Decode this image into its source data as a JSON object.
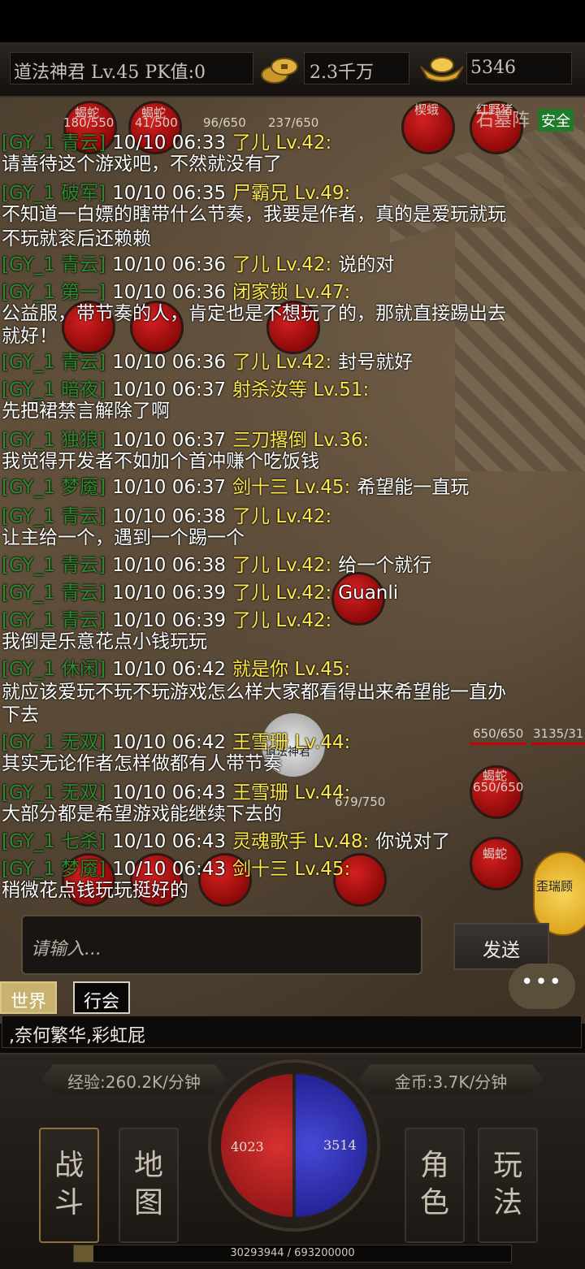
{
  "header": {
    "player_info": "道法神君  Lv.45 PK值:0",
    "gold": "2.3千万",
    "ingot": "5346"
  },
  "scene": {
    "zone": "石墓阵",
    "safe_zone": "安全",
    "player_name": "道法神君",
    "npc_name": "歪瑞顾",
    "monsters": [
      {
        "name": "蝎蛇",
        "hp": "180/550"
      },
      {
        "name": "蝎蛇",
        "hp": "41/500"
      },
      {
        "name": "",
        "hp": "96/650"
      },
      {
        "name": "",
        "hp": "237/650"
      },
      {
        "name": "楔蛾",
        "hp": ""
      },
      {
        "name": "红野猪",
        "hp": ""
      },
      {
        "name": "蝎蛇",
        "hp": "650/650"
      },
      {
        "name": "",
        "hp": "3135/31"
      },
      {
        "name": "",
        "hp": "679/750"
      },
      {
        "name": "蝎蛇",
        "hp": ""
      }
    ]
  },
  "chat": {
    "lines": [
      {
        "channel": "[GY_1  青云]",
        "time": "10/10 06:33",
        "name": "了儿 Lv.42:",
        "msg": ""
      },
      {
        "channel": "",
        "time": "",
        "name": "",
        "msg": "请善待这个游戏吧，不然就没有了"
      },
      {
        "channel": "[GY_1  破军]",
        "time": "10/10 06:35",
        "name": "尸霸兄 Lv.49:",
        "msg": ""
      },
      {
        "channel": "",
        "time": "",
        "name": "",
        "msg": "不知道一白嫖的瞎带什么节奏，我要是作者，真的是爱玩就玩"
      },
      {
        "channel": "",
        "time": "",
        "name": "",
        "msg": "不玩就衮后还赖赖"
      },
      {
        "channel": "[GY_1  青云]",
        "time": "10/10 06:36",
        "name": "了儿 Lv.42:",
        "msg": "说的对"
      },
      {
        "channel": "[GY_1  第一]",
        "time": "10/10 06:36",
        "name": "闭家锁 Lv.47:",
        "msg": ""
      },
      {
        "channel": "",
        "time": "",
        "name": "",
        "msg": "公益服，带节奏的人，肯定也是不想玩了的，那就直接踢出去"
      },
      {
        "channel": "",
        "time": "",
        "name": "",
        "msg": "就好！"
      },
      {
        "channel": "[GY_1  青云]",
        "time": "10/10 06:36",
        "name": "了儿 Lv.42:",
        "msg": "封号就好"
      },
      {
        "channel": "[GY_1  暗夜]",
        "time": "10/10 06:37",
        "name": "射杀汝等 Lv.51:",
        "msg": ""
      },
      {
        "channel": "",
        "time": "",
        "name": "",
        "msg": "先把裙禁言解除了啊"
      },
      {
        "channel": "[GY_1  独狼]",
        "time": "10/10 06:37",
        "name": "三刀撂倒 Lv.36:",
        "msg": ""
      },
      {
        "channel": "",
        "time": "",
        "name": "",
        "msg": "我觉得开发者不如加个首冲赚个吃饭钱"
      },
      {
        "channel": "[GY_1  梦魇]",
        "time": "10/10 06:37",
        "name": "剑十三 Lv.45:",
        "msg": "希望能一直玩"
      },
      {
        "channel": "[GY_1  青云]",
        "time": "10/10 06:38",
        "name": "了儿 Lv.42:",
        "msg": ""
      },
      {
        "channel": "",
        "time": "",
        "name": "",
        "msg": "让主给一个，遇到一个踢一个"
      },
      {
        "channel": "[GY_1  青云]",
        "time": "10/10 06:38",
        "name": "了儿 Lv.42:",
        "msg": "给一个就行"
      },
      {
        "channel": "[GY_1  青云]",
        "time": "10/10 06:39",
        "name": "了儿 Lv.42:",
        "msg": "Guanli"
      },
      {
        "channel": "[GY_1  青云]",
        "time": "10/10 06:39",
        "name": "了儿 Lv.42:",
        "msg": ""
      },
      {
        "channel": "",
        "time": "",
        "name": "",
        "msg": "我倒是乐意花点小钱玩玩"
      },
      {
        "channel": "[GY_1  休闲]",
        "time": "10/10 06:42",
        "name": "就是你 Lv.45:",
        "msg": ""
      },
      {
        "channel": "",
        "time": "",
        "name": "",
        "msg": "就应该爱玩不玩不玩游戏怎么样大家都看得出来希望能一直办"
      },
      {
        "channel": "",
        "time": "",
        "name": "",
        "msg": "下去"
      },
      {
        "channel": "[GY_1  无双]",
        "time": "10/10 06:42",
        "name": "王雪珊 Lv.44:",
        "msg": ""
      },
      {
        "channel": "",
        "time": "",
        "name": "",
        "msg": "其实无论作者怎样做都有人带节奏"
      },
      {
        "channel": "[GY_1  无双]",
        "time": "10/10 06:43",
        "name": "王雪珊 Lv.44:",
        "msg": ""
      },
      {
        "channel": "",
        "time": "",
        "name": "",
        "msg": "大部分都是希望游戏能继续下去的"
      },
      {
        "channel": "[GY_1  七杀]",
        "time": "10/10 06:43",
        "name": "灵魂歌手 Lv.48:",
        "msg": "你说对了"
      },
      {
        "channel": "[GY_1  梦魇]",
        "time": "10/10 06:43",
        "name": "剑十三 Lv.45:",
        "msg": ""
      },
      {
        "channel": "",
        "time": "",
        "name": "",
        "msg": "稍微花点钱玩玩挺好的"
      }
    ],
    "input_placeholder": "请输入...",
    "send_label": "发送",
    "bubble_dots": "•••",
    "tabs": {
      "world": "世界",
      "guild": "行会"
    },
    "marquee": ",奈何繁华,彩虹屁"
  },
  "bottom": {
    "exp_rate": "经验:260.2K/分钟",
    "gold_rate": "金币:3.7K/分钟",
    "hp": "4023",
    "mp": "3514",
    "nav": {
      "battle": "战斗",
      "map": "地图",
      "role": "角色",
      "play": "玩法"
    },
    "exp_text": "30293944 / 693200000",
    "exp_progress": 0.0437
  },
  "colors": {
    "channel": "#2f8a2f",
    "name": "#ffe84a",
    "safe": "#1f7a2a"
  }
}
